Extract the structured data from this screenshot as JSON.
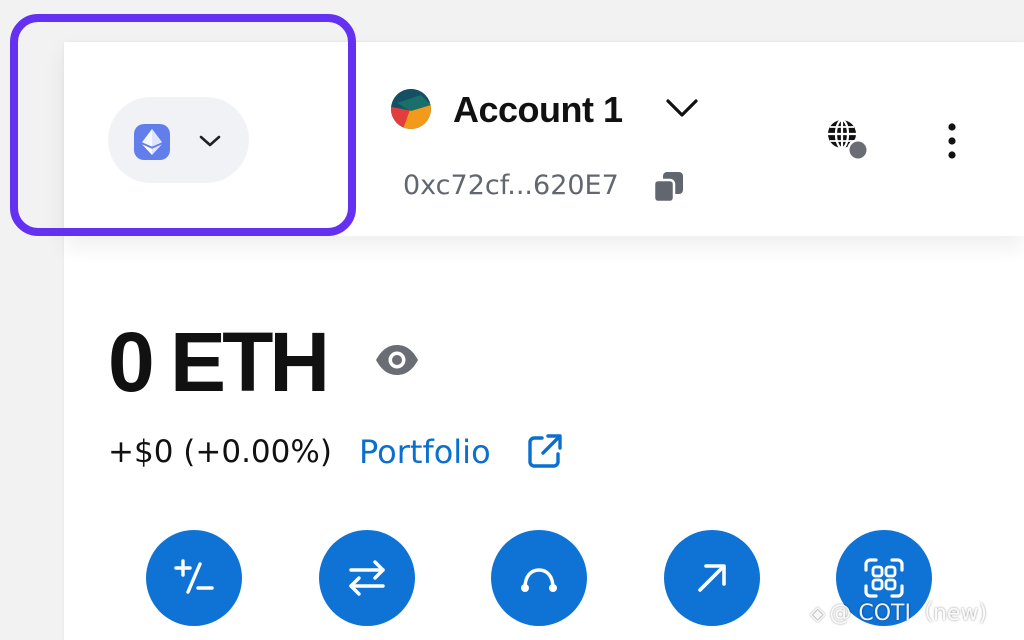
{
  "network": {
    "selected": "Ethereum",
    "badge_color": "#627eea",
    "icon": "ethereum-icon"
  },
  "account": {
    "name": "Account 1",
    "address": "0xc72cf...620E7"
  },
  "balance": {
    "amount": "0 ETH",
    "change": "+$0 (+0.00%)",
    "portfolio_label": "Portfolio"
  },
  "actions": [
    {
      "icon": "buy-sell-icon"
    },
    {
      "icon": "swap-icon"
    },
    {
      "icon": "bridge-icon"
    },
    {
      "icon": "send-icon"
    },
    {
      "icon": "receive-icon"
    }
  ],
  "colors": {
    "accent": "#0f73d6",
    "link": "#0a6fd1",
    "highlight": "#6431f2"
  },
  "watermark": {
    "text": "@ COTI（new)"
  }
}
